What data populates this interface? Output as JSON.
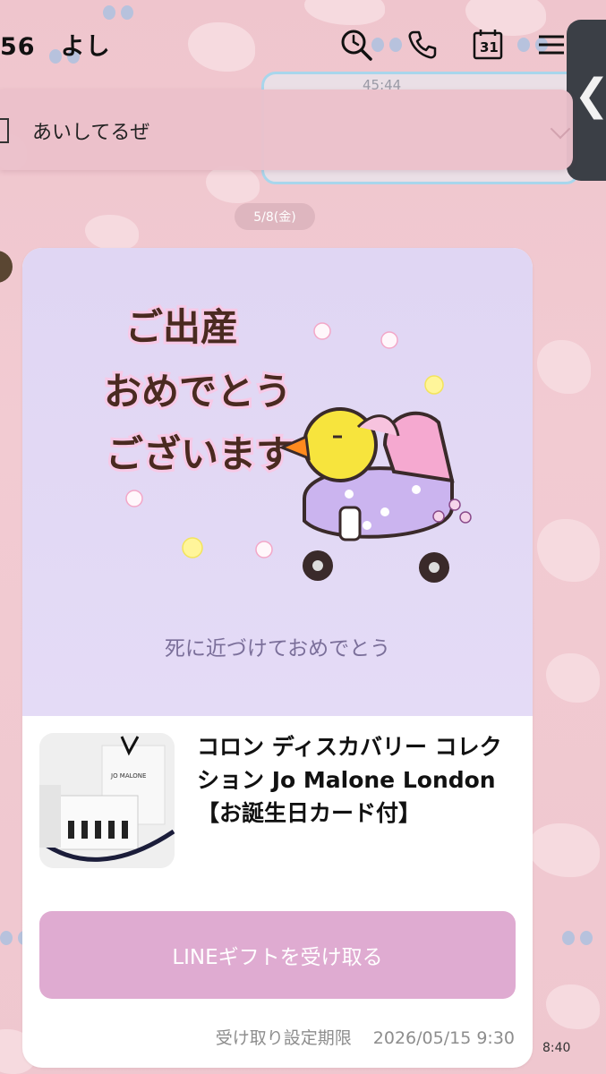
{
  "header": {
    "title": "56　よし",
    "icons": [
      "search-icon",
      "phone-icon",
      "calendar-icon",
      "menu-icon"
    ],
    "calendar_day": "31"
  },
  "previous_message": {
    "time": "45:44"
  },
  "pinned": {
    "text": "あいしてるぜ"
  },
  "date_separator": "5/8(金)",
  "gift_card": {
    "sticker_text": [
      "ご出産",
      "おめでとう",
      "ございます"
    ],
    "message": "死に近づけておめでとう",
    "product_name": "コロン ディスカバリー コレクション Jo Malone London【お誕生日カード付】",
    "button_label": "LINEギフトを受け取る",
    "deadline_label": "受け取り設定期限",
    "deadline_value": "2026/05/15 9:30",
    "thumb_brand": "JO MALONE"
  },
  "message_time": "8:40",
  "colors": {
    "button": "#dfabd1",
    "card_top": "#e0d6f3",
    "background": "#efc5cd"
  }
}
